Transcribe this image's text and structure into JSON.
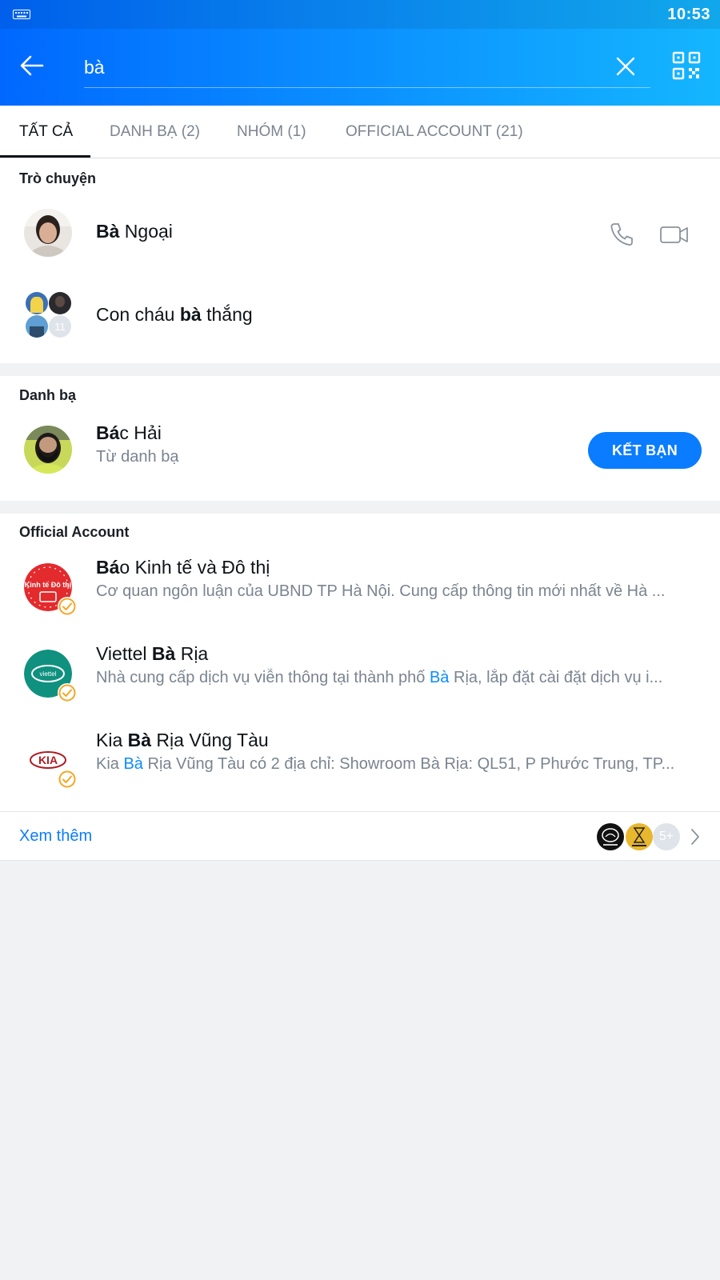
{
  "status_bar": {
    "time": "10:53",
    "keyboard_icon": "keyboard-icon"
  },
  "header": {
    "back_icon": "arrow-left-icon",
    "search_value": "bà",
    "clear_icon": "close-icon",
    "qr_icon": "qr-code-icon"
  },
  "tabs": [
    {
      "label": "TẤT CẢ",
      "active": true
    },
    {
      "label": "DANH BẠ (2)",
      "active": false
    },
    {
      "label": "NHÓM (1)",
      "active": false
    },
    {
      "label": "OFFICIAL ACCOUNT (21)",
      "active": false
    }
  ],
  "chats": {
    "title": "Trò chuyện",
    "items": [
      {
        "name_bold": "Bà",
        "name_rest": " Ngoại",
        "call_icon": "phone-icon",
        "video_icon": "video-camera-icon"
      },
      {
        "name_pre": "Con cháu ",
        "name_bold": "bà",
        "name_rest": " thắng",
        "member_extra": "11"
      }
    ]
  },
  "contacts": {
    "title": "Danh bạ",
    "items": [
      {
        "name_bold": "Bá",
        "name_rest": "c Hải",
        "subtitle": "Từ danh bạ",
        "button": "KẾT BẠN"
      }
    ]
  },
  "official": {
    "title": "Official Account",
    "items": [
      {
        "name_bold": "Bá",
        "name_rest": "o Kinh tế và Đô thị",
        "desc_pre": "Cơ quan ngôn luận của UBND TP Hà Nội. Cung cấp thông tin mới nhất về Hà ...",
        "desc_hl": "",
        "desc_post": "",
        "logo_text": "Kinh tế Đô thị"
      },
      {
        "name_pre": "Viettel ",
        "name_bold": "Bà",
        "name_rest": " Rịa",
        "desc_pre": "Nhà cung cấp dịch vụ viễn thông tại thành phố ",
        "desc_hl": "Bà",
        "desc_post": " Rịa, lắp đặt cài đặt dịch vụ i...",
        "logo_text": "viettel"
      },
      {
        "name_pre": "Kia ",
        "name_bold": "Bà",
        "name_rest": " Rịa Vũng Tàu",
        "desc_pre": "Kia ",
        "desc_hl": "Bà",
        "desc_post": " Rịa Vũng Tàu có 2 địa chỉ: Showroom Bà Rịa: QL51, P Phước Trung, TP...",
        "logo_text": "KIA"
      }
    ]
  },
  "see_more": {
    "label": "Xem thêm",
    "extra_count": "5+",
    "chevron_icon": "chevron-right-icon"
  },
  "colors": {
    "accent": "#0a7cff",
    "highlight": "#0a8cff",
    "header_start": "#0068ff",
    "header_end": "#14b6ff",
    "verified": "#f5a623"
  }
}
